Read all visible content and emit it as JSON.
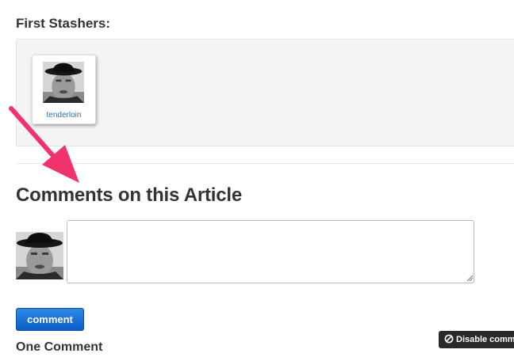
{
  "stashers": {
    "heading": "First Stashers:",
    "items": [
      {
        "username": "tenderloin"
      }
    ]
  },
  "comments": {
    "heading": "Comments on this Article",
    "textarea_value": "",
    "submit_label": "comment",
    "count_label": "One Comment"
  },
  "widget": {
    "disable_label": "Disable comments"
  },
  "colors": {
    "accent": "#0b5cc6",
    "link": "#2b6fb3",
    "annotation_arrow": "#f0336d"
  },
  "icons": {
    "avatar": "user-portrait-with-hat",
    "disable": "prohibited-circle-icon"
  }
}
